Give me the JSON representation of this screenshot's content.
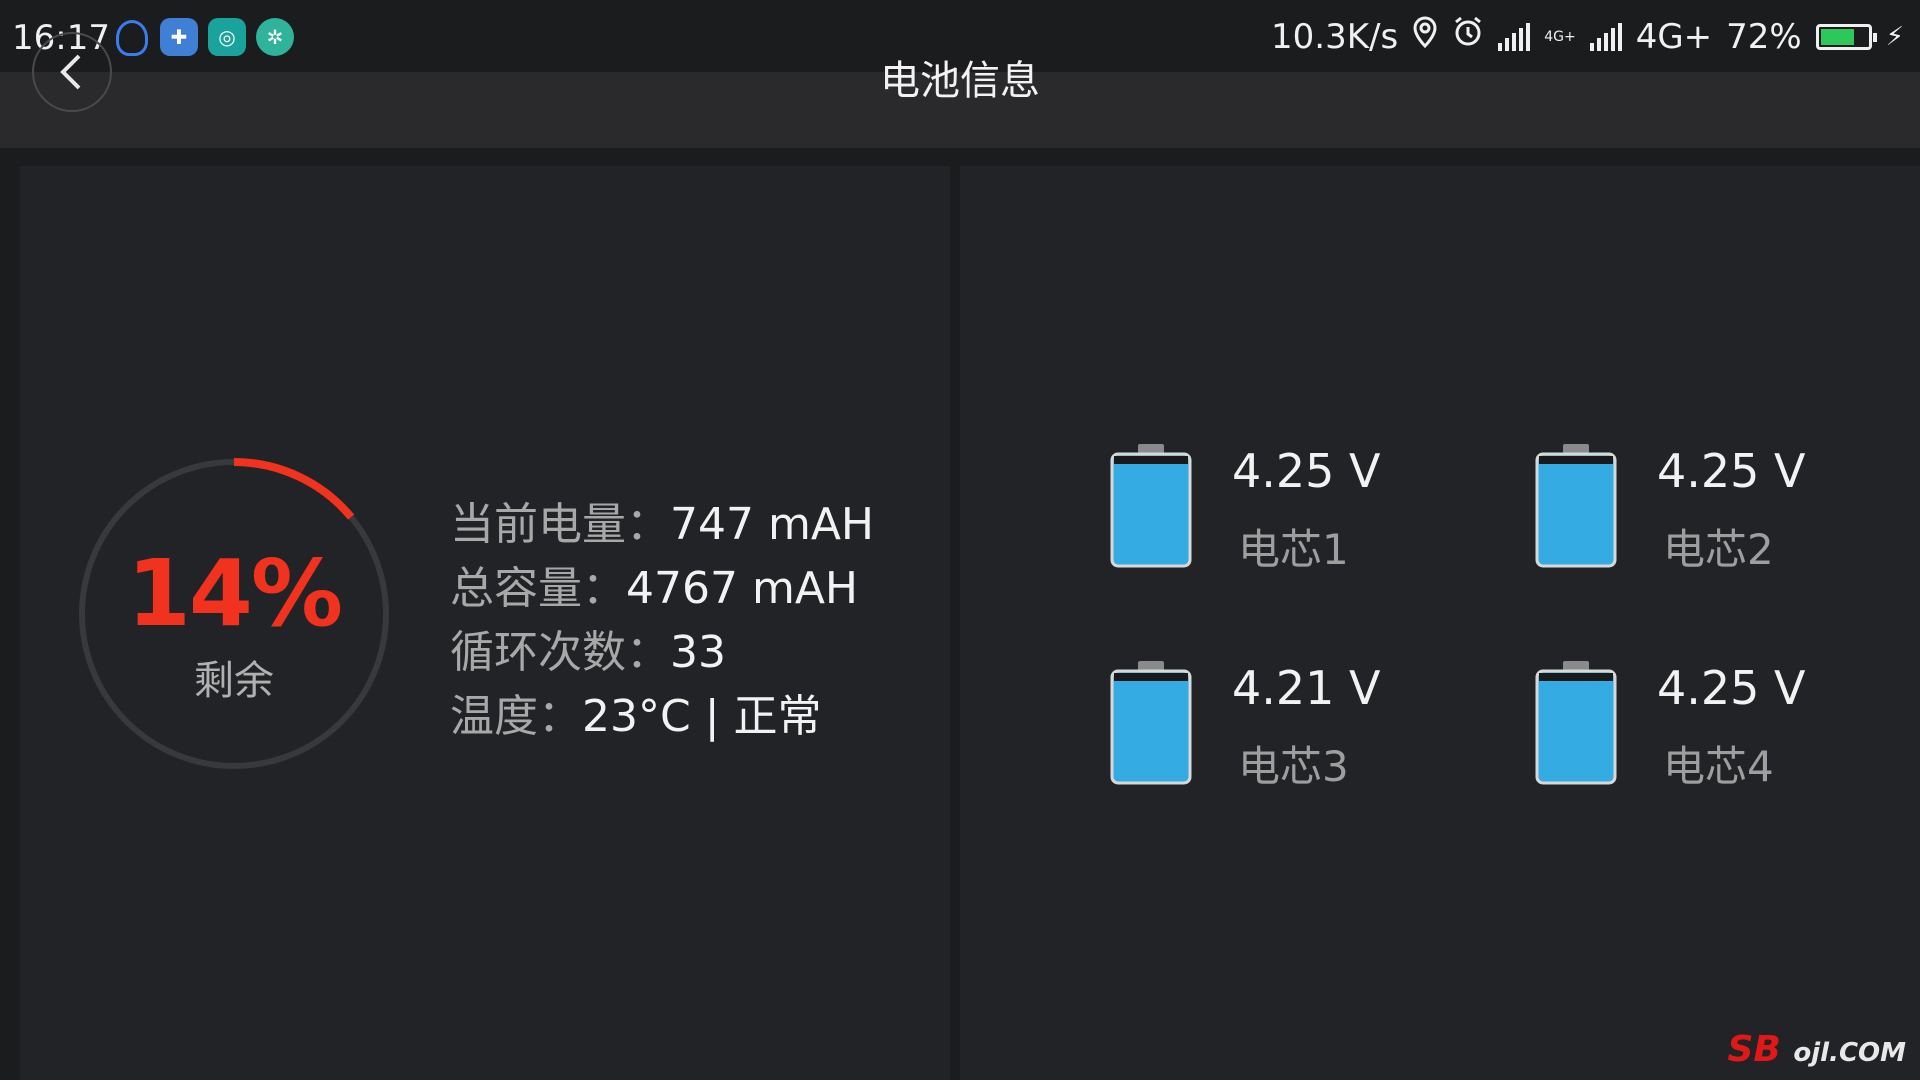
{
  "status_bar": {
    "time": "16:17",
    "net_speed": "10.3K/s",
    "network_type": "4G+",
    "network_small": "4G+",
    "battery_pct": "72%",
    "battery_level": 0.72,
    "icons": [
      "location-icon",
      "alarm-icon",
      "signal-icon",
      "signal-icon",
      "battery-icon",
      "charging-icon"
    ]
  },
  "title_bar": {
    "title": "电池信息",
    "back_icon": "chevron-left-icon"
  },
  "gauge": {
    "percent_text": "14%",
    "percent_value": 14,
    "label": "剩余",
    "color": "#f0321e",
    "track_color": "#38393c"
  },
  "info": {
    "current_charge": {
      "label": "当前电量：",
      "value": "747 mAH"
    },
    "total_capacity": {
      "label": "总容量：",
      "value": "4767 mAH"
    },
    "cycle_count": {
      "label": "循环次数：",
      "value": "33"
    },
    "temperature": {
      "label": "温度：",
      "value": "23°C | 正常"
    }
  },
  "cells": [
    {
      "voltage": "4.25 V",
      "name": "电芯1"
    },
    {
      "voltage": "4.25 V",
      "name": "电芯2"
    },
    {
      "voltage": "4.21 V",
      "name": "电芯3"
    },
    {
      "voltage": "4.25 V",
      "name": "电芯4"
    }
  ],
  "colors": {
    "accent": "#f0321e",
    "cell_fill": "#34ace3",
    "background": "#1b1c1e",
    "panel": "#222326"
  },
  "watermark": {
    "brand": "SB",
    "rest": "ojl.COM"
  }
}
